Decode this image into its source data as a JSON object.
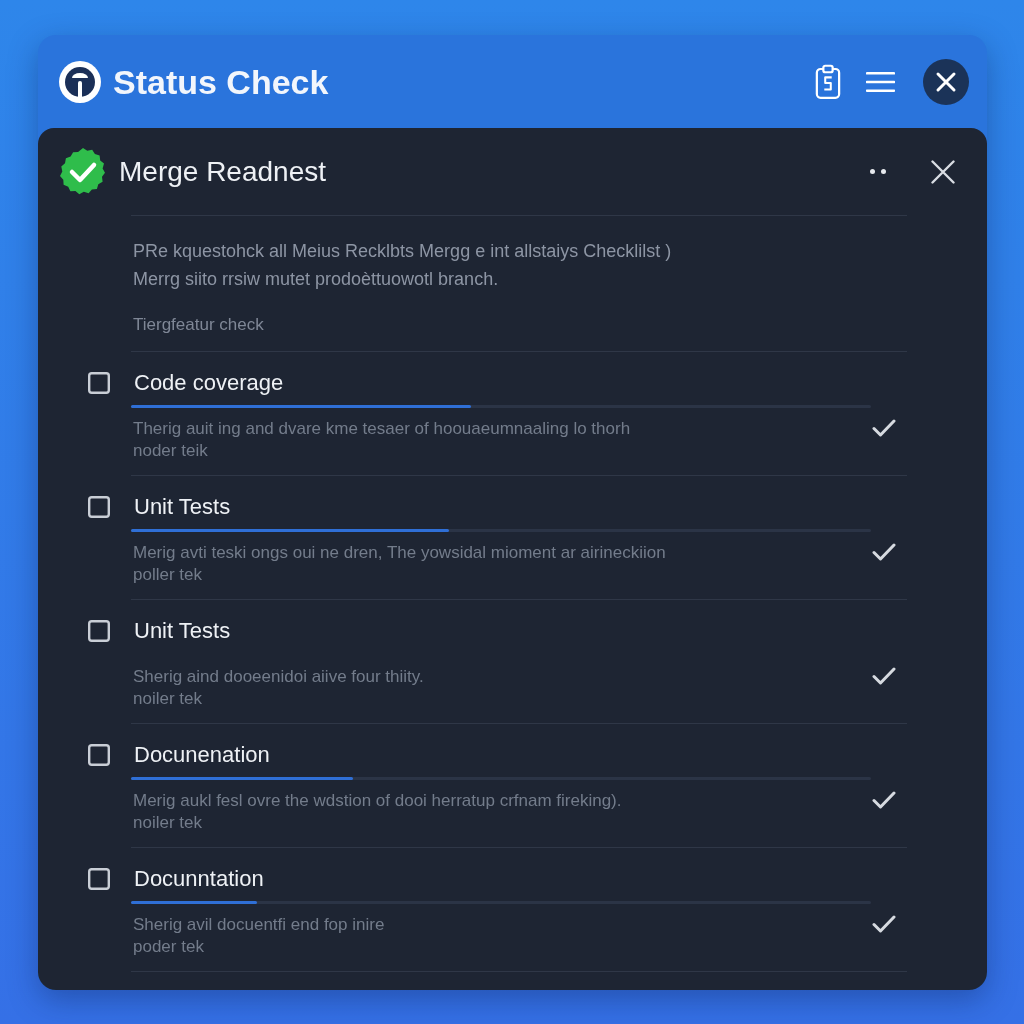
{
  "window": {
    "title": "Status Check"
  },
  "panel": {
    "title": "Merge Readnest",
    "description": "PRe kquestohck all Meius Recklbts Mergg e int allstaiys Checklilst )\nMerrg siito rrsiw mutet prodoèttuowotl branch.",
    "subtitle": "Tiergfeatur check"
  },
  "items": [
    {
      "title": "Code coverage",
      "checked": false,
      "level": 0.46,
      "description": "Therig auit ing and dvare kme tesaer of hoouaeumnaaling lo thorh\nnoder teik",
      "verified": true
    },
    {
      "title": "Unit Tests",
      "checked": false,
      "level": 0.43,
      "description": "Merig avti teski ongs oui ne dren, The yowsidal mioment ar airineckiion\npoller tek",
      "verified": true
    },
    {
      "title": "Unit Tests",
      "checked": false,
      "description": "Sherig aind dooeenidoi aiive four thiity.\nnoiler tek",
      "verified": true
    },
    {
      "title": "Docunenation",
      "checked": false,
      "level": 0.3,
      "description": "Merig aukl fesl ovre the wdstion of dooi herratup crfnam fireking).\nnoiler tek",
      "verified": true
    },
    {
      "title": "Docunntation",
      "checked": false,
      "level": 0.17,
      "description": "Sherig avil docuentfi end fop inire\npoder tek",
      "verified": true
    }
  ]
}
